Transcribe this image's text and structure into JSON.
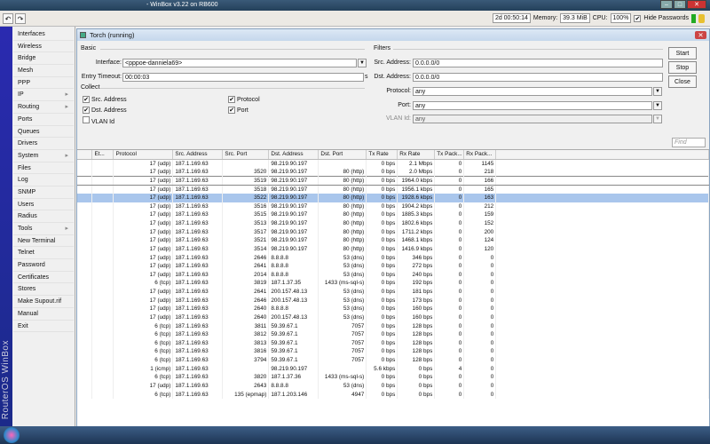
{
  "window": {
    "title": "- WinBox v3.22 on RB600"
  },
  "toolbar": {
    "undo": "↶",
    "redo": "↷",
    "uptime": "2d 00:50:14",
    "memory_label": "Memory:",
    "memory": "39.3 MiB",
    "cpu_label": "CPU:",
    "cpu": "100%",
    "hide_passwords": "Hide Passwords",
    "hide_passwords_checked": true
  },
  "sidebar": {
    "brand": "RouterOS WinBox",
    "items": [
      {
        "label": "Interfaces"
      },
      {
        "label": "Wireless"
      },
      {
        "label": "Bridge"
      },
      {
        "label": "Mesh"
      },
      {
        "label": "PPP"
      },
      {
        "label": "IP",
        "submenu": true
      },
      {
        "label": "Routing",
        "submenu": true
      },
      {
        "label": "Ports"
      },
      {
        "label": "Queues"
      },
      {
        "label": "Drivers"
      },
      {
        "label": "System",
        "submenu": true
      },
      {
        "label": "Files"
      },
      {
        "label": "Log"
      },
      {
        "label": "SNMP"
      },
      {
        "label": "Users"
      },
      {
        "label": "Radius"
      },
      {
        "label": "Tools",
        "submenu": true
      },
      {
        "label": "New Terminal"
      },
      {
        "label": "Telnet"
      },
      {
        "label": "Password"
      },
      {
        "label": "Certificates"
      },
      {
        "label": "Stores"
      },
      {
        "label": "Make Supout.rif"
      },
      {
        "label": "Manual"
      },
      {
        "label": "Exit"
      }
    ]
  },
  "torch": {
    "title": "Torch (running)",
    "basic": {
      "legend": "Basic",
      "interface_label": "Interface:",
      "interface": "<pppoe-danniela69>",
      "timeout_label": "Entry Timeout:",
      "timeout": "00:00:03",
      "timeout_unit": "s"
    },
    "collect": {
      "legend": "Collect",
      "src_address": "Src. Address",
      "dst_address": "Dst. Address",
      "vlan_id": "VLAN Id",
      "protocol": "Protocol",
      "port": "Port"
    },
    "filters": {
      "legend": "Filters",
      "src_label": "Src. Address:",
      "src": "0.0.0.0/0",
      "dst_label": "Dst. Address:",
      "dst": "0.0.0.0/0",
      "protocol_label": "Protocol:",
      "protocol": "any",
      "port_label": "Port:",
      "port": "any",
      "vlan_label": "VLAN Id:",
      "vlan": "any"
    },
    "buttons": {
      "start": "Start",
      "stop": "Stop",
      "close": "Close"
    },
    "find_placeholder": "Find",
    "columns": [
      "",
      "Et...",
      "Protocol",
      "Src. Address",
      "Src. Port",
      "Dst. Address",
      "Dst. Port",
      "Tx Rate",
      "Rx Rate",
      "Tx Pack...",
      "Rx Pack..."
    ],
    "rows": [
      [
        "17 (udp)",
        "187.1.169.63",
        "",
        "98.219.90.197",
        "",
        "0 bps",
        "2.1 Mbps",
        "0",
        "1145"
      ],
      [
        "17 (udp)",
        "187.1.169.63",
        "3520",
        "98.219.90.197",
        "80 (http)",
        "0 bps",
        "2.0 Mbps",
        "0",
        "218"
      ],
      [
        "17 (udp)",
        "187.1.169.63",
        "3519",
        "98.219.90.197",
        "80 (http)",
        "0 bps",
        "1964.0 kbps",
        "0",
        "166"
      ],
      [
        "17 (udp)",
        "187.1.169.63",
        "3518",
        "98.219.90.197",
        "80 (http)",
        "0 bps",
        "1956.1 kbps",
        "0",
        "165"
      ],
      [
        "17 (udp)",
        "187.1.169.63",
        "3522",
        "98.219.90.197",
        "80 (http)",
        "0 bps",
        "1928.6 kbps",
        "0",
        "163"
      ],
      [
        "17 (udp)",
        "187.1.169.63",
        "3516",
        "98.219.90.197",
        "80 (http)",
        "0 bps",
        "1904.2 kbps",
        "0",
        "212"
      ],
      [
        "17 (udp)",
        "187.1.169.63",
        "3515",
        "98.219.90.197",
        "80 (http)",
        "0 bps",
        "1885.3 kbps",
        "0",
        "159"
      ],
      [
        "17 (udp)",
        "187.1.169.63",
        "3513",
        "98.219.90.197",
        "80 (http)",
        "0 bps",
        "1802.6 kbps",
        "0",
        "152"
      ],
      [
        "17 (udp)",
        "187.1.169.63",
        "3517",
        "98.219.90.197",
        "80 (http)",
        "0 bps",
        "1711.2 kbps",
        "0",
        "200"
      ],
      [
        "17 (udp)",
        "187.1.169.63",
        "3521",
        "98.219.90.197",
        "80 (http)",
        "0 bps",
        "1468.1 kbps",
        "0",
        "124"
      ],
      [
        "17 (udp)",
        "187.1.169.63",
        "3514",
        "98.219.90.197",
        "80 (http)",
        "0 bps",
        "1416.9 kbps",
        "0",
        "120"
      ],
      [
        "17 (udp)",
        "187.1.169.63",
        "2646",
        "8.8.8.8",
        "53 (dns)",
        "0 bps",
        "346 bps",
        "0",
        "0"
      ],
      [
        "17 (udp)",
        "187.1.169.63",
        "2641",
        "8.8.8.8",
        "53 (dns)",
        "0 bps",
        "272 bps",
        "0",
        "0"
      ],
      [
        "17 (udp)",
        "187.1.169.63",
        "2014",
        "8.8.8.8",
        "53 (dns)",
        "0 bps",
        "240 bps",
        "0",
        "0"
      ],
      [
        "6 (tcp)",
        "187.1.169.63",
        "3819",
        "187.1.37.35",
        "1433 (ms-sql-s)",
        "0 bps",
        "192 bps",
        "0",
        "0"
      ],
      [
        "17 (udp)",
        "187.1.169.63",
        "2641",
        "200.157.48.13",
        "53 (dns)",
        "0 bps",
        "181 bps",
        "0",
        "0"
      ],
      [
        "17 (udp)",
        "187.1.169.63",
        "2646",
        "200.157.48.13",
        "53 (dns)",
        "0 bps",
        "173 bps",
        "0",
        "0"
      ],
      [
        "17 (udp)",
        "187.1.169.63",
        "2640",
        "8.8.8.8",
        "53 (dns)",
        "0 bps",
        "160 bps",
        "0",
        "0"
      ],
      [
        "17 (udp)",
        "187.1.169.63",
        "2640",
        "200.157.48.13",
        "53 (dns)",
        "0 bps",
        "160 bps",
        "0",
        "0"
      ],
      [
        "6 (tcp)",
        "187.1.169.63",
        "3811",
        "59.39.67.1",
        "7057",
        "0 bps",
        "128 bps",
        "0",
        "0"
      ],
      [
        "6 (tcp)",
        "187.1.169.63",
        "3812",
        "59.39.67.1",
        "7057",
        "0 bps",
        "128 bps",
        "0",
        "0"
      ],
      [
        "6 (tcp)",
        "187.1.169.63",
        "3813",
        "59.39.67.1",
        "7057",
        "0 bps",
        "128 bps",
        "0",
        "0"
      ],
      [
        "6 (tcp)",
        "187.1.169.63",
        "3816",
        "59.39.67.1",
        "7057",
        "0 bps",
        "128 bps",
        "0",
        "0"
      ],
      [
        "6 (tcp)",
        "187.1.169.63",
        "3794",
        "59.39.67.1",
        "7057",
        "0 bps",
        "128 bps",
        "0",
        "0"
      ],
      [
        "1 (icmp)",
        "187.1.169.63",
        "",
        "98.219.90.197",
        "",
        "5.6 kbps",
        "0 bps",
        "4",
        "0"
      ],
      [
        "6 (tcp)",
        "187.1.169.63",
        "3820",
        "187.1.37.36",
        "1433 (ms-sql-s)",
        "0 bps",
        "0 bps",
        "0",
        "0"
      ],
      [
        "17 (udp)",
        "187.1.169.63",
        "2643",
        "8.8.8.8",
        "53 (dns)",
        "0 bps",
        "0 bps",
        "0",
        "0"
      ],
      [
        "6 (tcp)",
        "187.1.169.63",
        "135 (epmap)",
        "187.1.203.146",
        "4947",
        "0 bps",
        "0 bps",
        "0",
        "0"
      ]
    ],
    "selected_row": 4,
    "focused_row": 2
  }
}
